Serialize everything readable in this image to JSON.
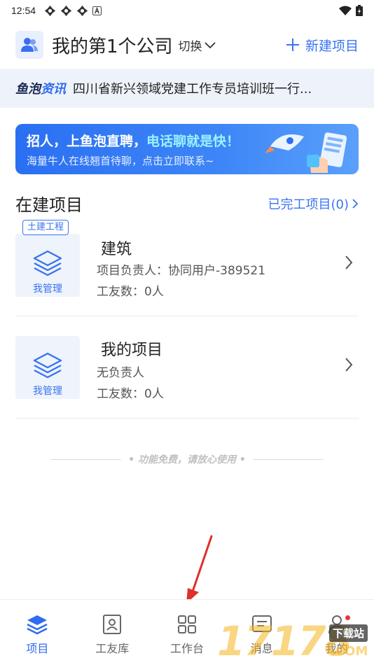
{
  "status_bar": {
    "time": "12:54"
  },
  "header": {
    "company": "我的第1个公司",
    "switch_label": "切换",
    "new_project_label": "新建项目"
  },
  "news": {
    "logo_part1": "鱼泡",
    "logo_part2": "资讯",
    "text": "四川省新兴领域党建工作专员培训班一行..."
  },
  "banner": {
    "title_part1": "招人，上鱼泡直聘，",
    "title_part2": "电话聊就是快！",
    "subtitle": "海量牛人在线翘首待聊，点击立即联系~"
  },
  "section": {
    "title": "在建项目",
    "completed_link": "已完工项目(0)"
  },
  "projects": [
    {
      "tag": "土建工程",
      "name": "建筑",
      "manager": "项目负责人：协同用户-389521",
      "workers": "工友数：0人",
      "manage_label": "我管理"
    },
    {
      "tag": "",
      "name": "我的项目",
      "manager": "无负责人",
      "workers": "工友数：0人",
      "manage_label": "我管理"
    }
  ],
  "footer_note": "• 功能免费，请放心使用 •",
  "bottom_nav": [
    {
      "label": "项目",
      "icon": "layers-icon",
      "active": true
    },
    {
      "label": "工友库",
      "icon": "contact-card-icon",
      "active": false
    },
    {
      "label": "工作台",
      "icon": "grid-icon",
      "active": false
    },
    {
      "label": "消息",
      "icon": "message-icon",
      "active": false
    },
    {
      "label": "我的",
      "icon": "person-icon",
      "active": false
    }
  ],
  "watermark": {
    "number": "17178",
    "com": ".COM",
    "download": "下载站"
  },
  "colors": {
    "accent": "#2f6cf0",
    "banner": "#2a6ff2",
    "annotation": "#e0302a"
  }
}
